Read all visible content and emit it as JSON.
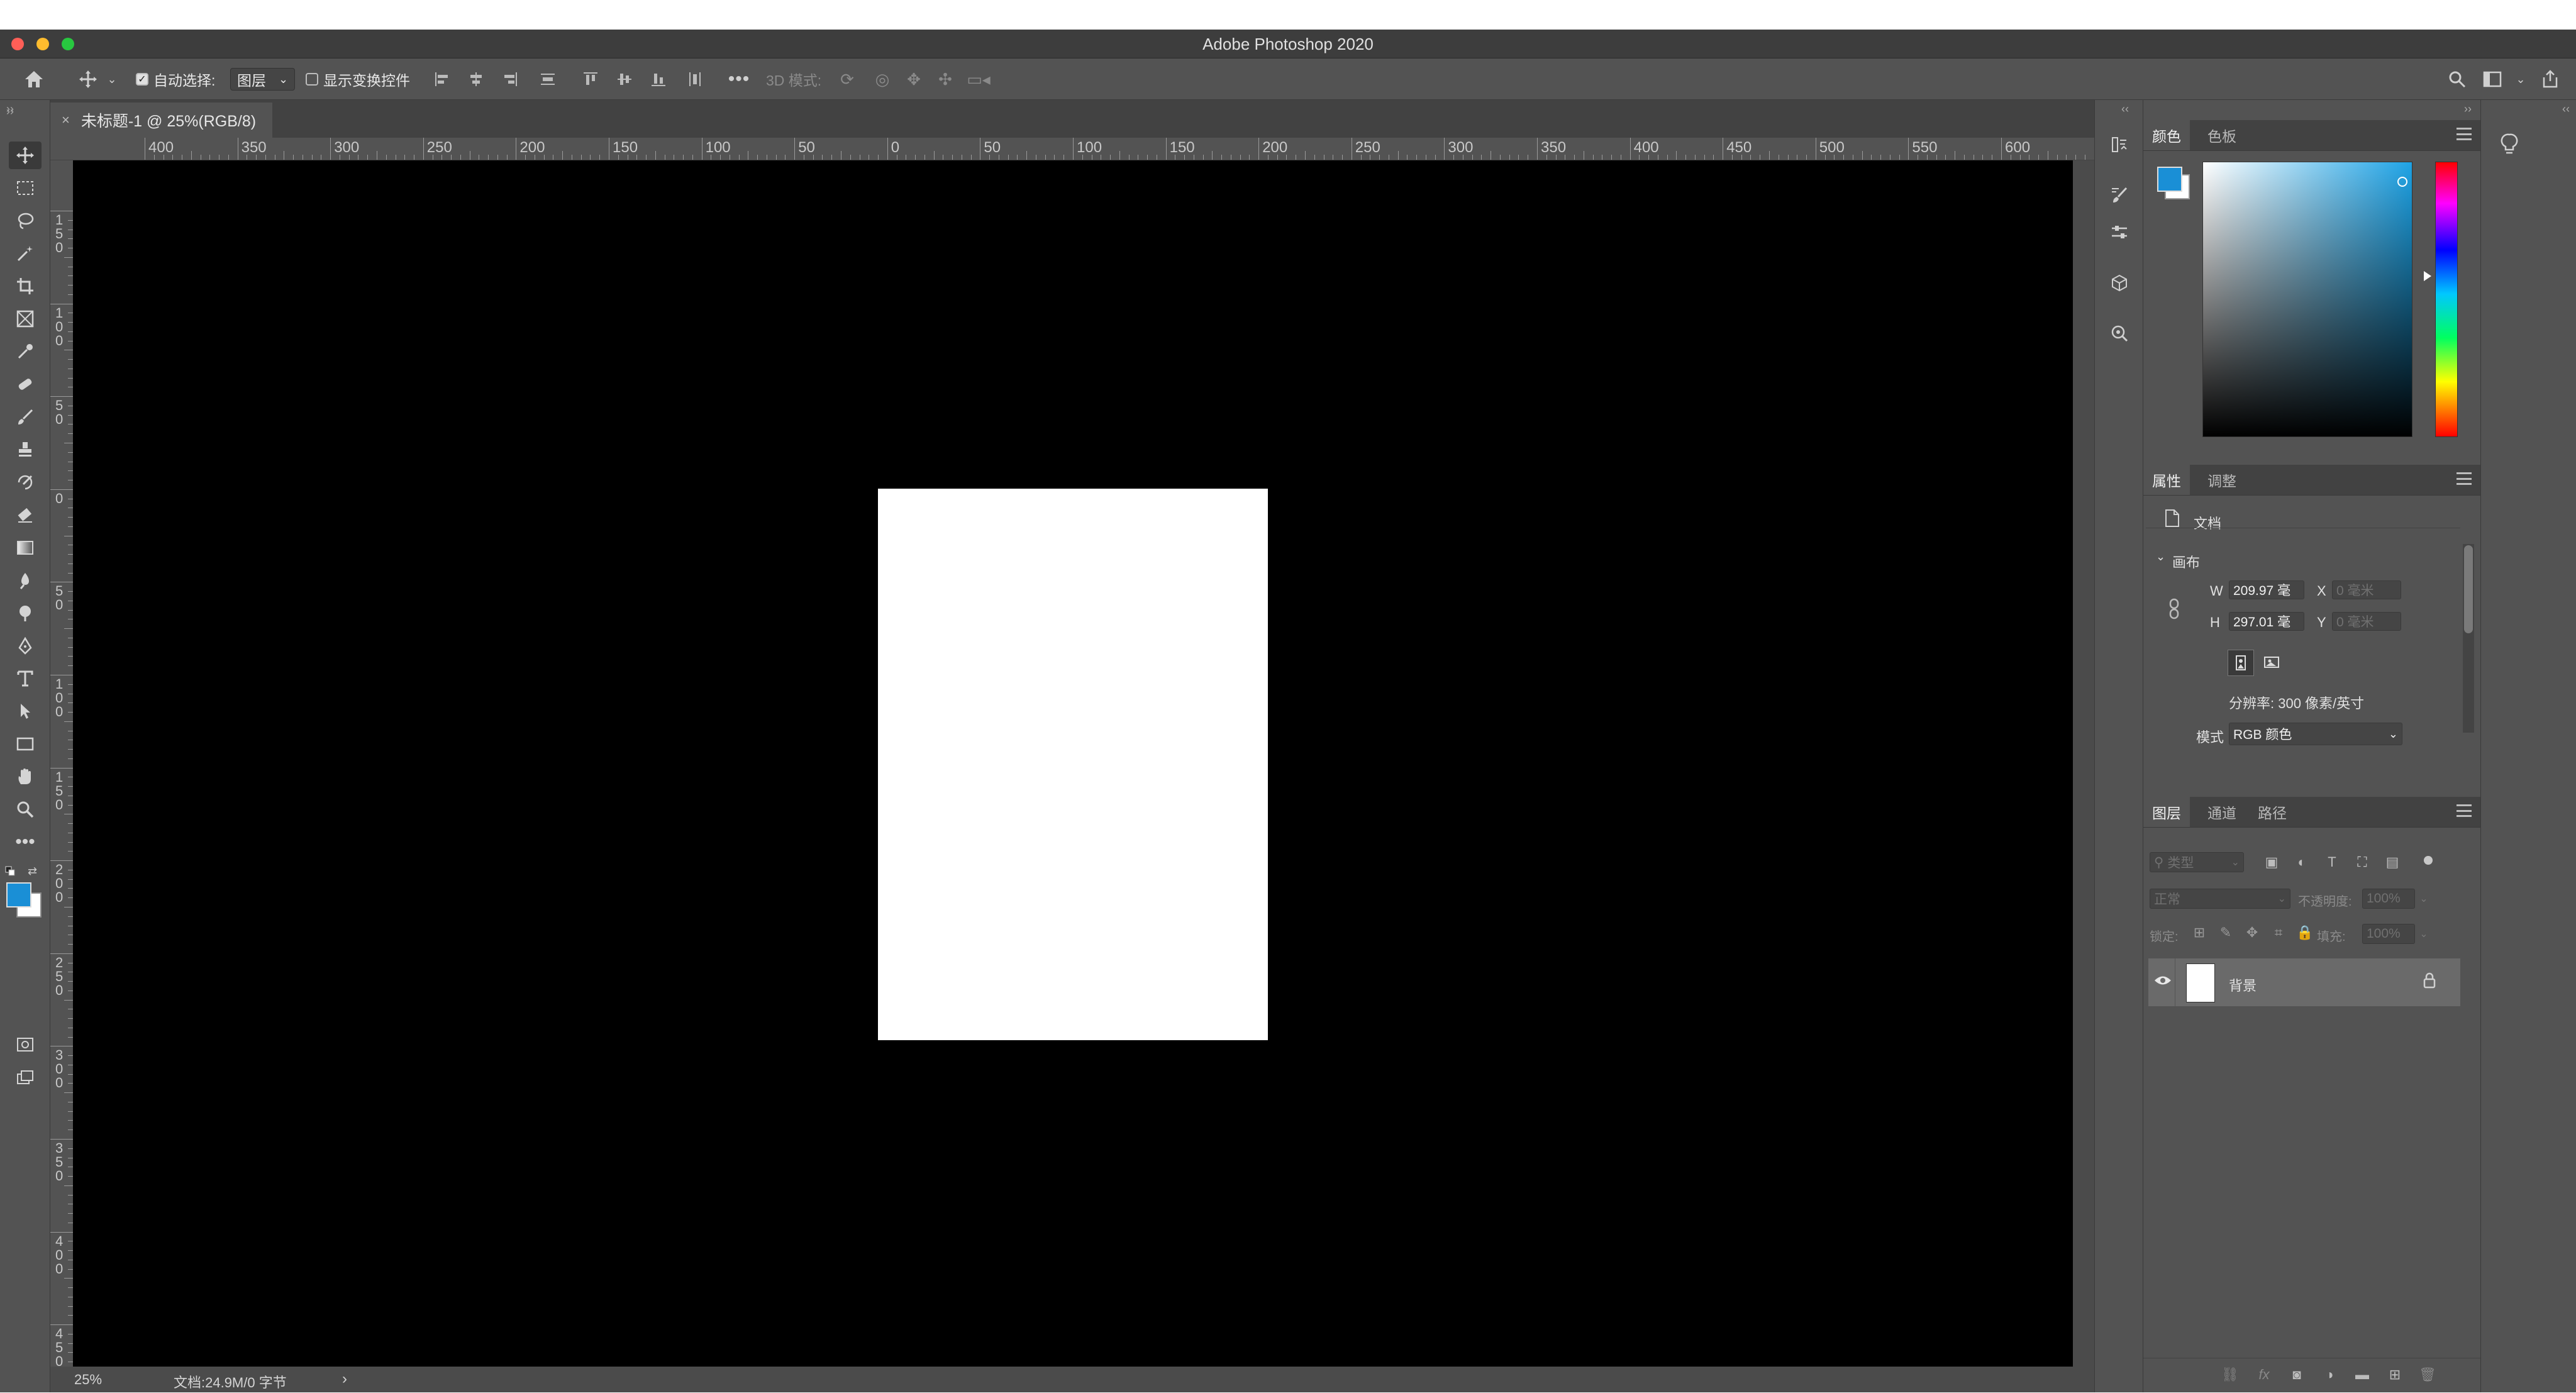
{
  "app": {
    "window_title": "Adobe Photoshop 2020"
  },
  "options_bar": {
    "auto_select_label": "自动选择:",
    "auto_select_checked": true,
    "auto_select_target": "图层",
    "show_transform_label": "显示变换控件",
    "show_transform_checked": false,
    "mode_3d_label": "3D 模式:"
  },
  "document_tab": {
    "title": "未标题-1 @ 25%(RGB/8)"
  },
  "ruler": {
    "top_labels": [
      "400",
      "350",
      "300",
      "250",
      "200",
      "150",
      "100",
      "50",
      "0",
      "50",
      "100",
      "150",
      "200",
      "250",
      "300",
      "350",
      "400",
      "450",
      "500",
      "550",
      "600"
    ],
    "left_labels": [
      "150",
      "100",
      "50",
      "0",
      "50",
      "100",
      "150",
      "200",
      "250",
      "300",
      "350",
      "400",
      "450"
    ]
  },
  "status_bar": {
    "zoom": "25%",
    "doc_info": "文档:24.9M/0 字节"
  },
  "color_panel": {
    "tabs": [
      "颜色",
      "色板"
    ],
    "foreground_color": "#1a8fd6",
    "background_color": "#ffffff",
    "hue_color": "#1ea3e6"
  },
  "properties_panel": {
    "tabs": [
      "属性",
      "调整"
    ],
    "doc_label": "文档",
    "canvas_section": "画布",
    "w_label": "W",
    "w_value": "209.97 毫",
    "x_label": "X",
    "x_placeholder": "0 毫米",
    "h_label": "H",
    "h_value": "297.01 毫",
    "y_label": "Y",
    "y_placeholder": "0 毫米",
    "resolution": "分辨率: 300 像素/英寸",
    "mode_label": "模式",
    "mode_value": "RGB 颜色"
  },
  "layers_panel": {
    "tabs": [
      "图层",
      "通道",
      "路径"
    ],
    "filter_placeholder": "类型",
    "blend_mode": "正常",
    "opacity_label": "不透明度:",
    "opacity_value": "100%",
    "lock_label": "锁定:",
    "fill_label": "填充:",
    "fill_value": "100%",
    "layers": [
      {
        "name": "背景",
        "visible": true,
        "locked": true
      }
    ]
  },
  "colors": {
    "canvas_bg": "#000000",
    "workspace": "#535353",
    "accent": "#1a8fd6"
  }
}
